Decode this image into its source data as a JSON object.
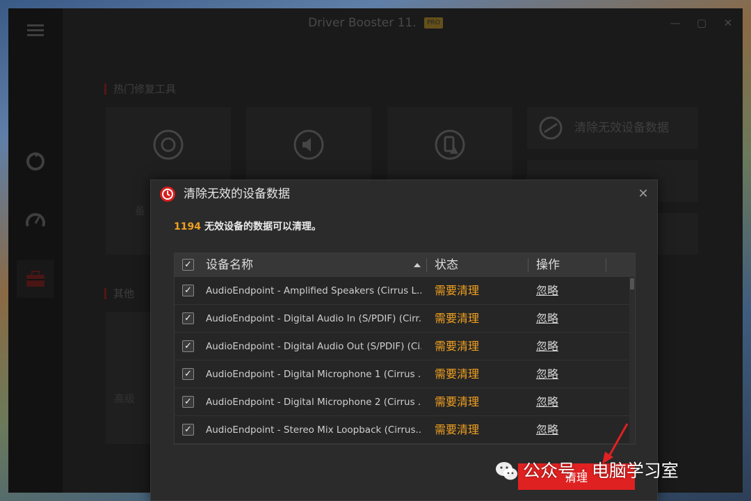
{
  "app": {
    "title": "Driver Booster 11.",
    "badge": "PRO",
    "window_controls": [
      "—",
      "▢",
      "✕"
    ]
  },
  "background": {
    "section_titles": [
      "热门修复工具",
      "其他"
    ],
    "right_tool": "清除无效设备数据",
    "card_labels": [
      "备",
      "高级"
    ]
  },
  "dialog": {
    "title": "清除无效的设备数据",
    "close": "✕",
    "summary_count": "1194",
    "summary_text": "无效设备的数据可以清理。",
    "columns": {
      "name": "设备名称",
      "status": "状态",
      "action": "操作"
    },
    "rows": [
      {
        "name": "AudioEndpoint - Amplified Speakers (Cirrus L...",
        "status": "需要清理",
        "action": "忽略",
        "checked": true
      },
      {
        "name": "AudioEndpoint - Digital Audio In (S/PDIF) (Cirr...",
        "status": "需要清理",
        "action": "忽略",
        "checked": true
      },
      {
        "name": "AudioEndpoint - Digital Audio Out (S/PDIF) (Ci...",
        "status": "需要清理",
        "action": "忽略",
        "checked": true
      },
      {
        "name": "AudioEndpoint - Digital Microphone 1 (Cirrus ...",
        "status": "需要清理",
        "action": "忽略",
        "checked": true
      },
      {
        "name": "AudioEndpoint - Digital Microphone 2 (Cirrus ...",
        "status": "需要清理",
        "action": "忽略",
        "checked": true
      },
      {
        "name": "AudioEndpoint - Stereo Mix Loopback (Cirrus...",
        "status": "需要清理",
        "action": "忽略",
        "checked": true
      }
    ],
    "clean_button": "清理"
  },
  "watermark": {
    "text": "公众号 · 电脑学习室"
  },
  "colors": {
    "accent_red": "#e02121",
    "status_orange": "#f0a020",
    "dialog_bg": "#2b2b2b"
  },
  "icons": [
    "menu-icon",
    "refresh-icon",
    "speed-icon",
    "toolbox-icon",
    "restore-icon",
    "mute-icon",
    "device-warning-icon",
    "device-clean-icon",
    "close-icon",
    "sort-arrow-icon",
    "wechat-icon"
  ]
}
